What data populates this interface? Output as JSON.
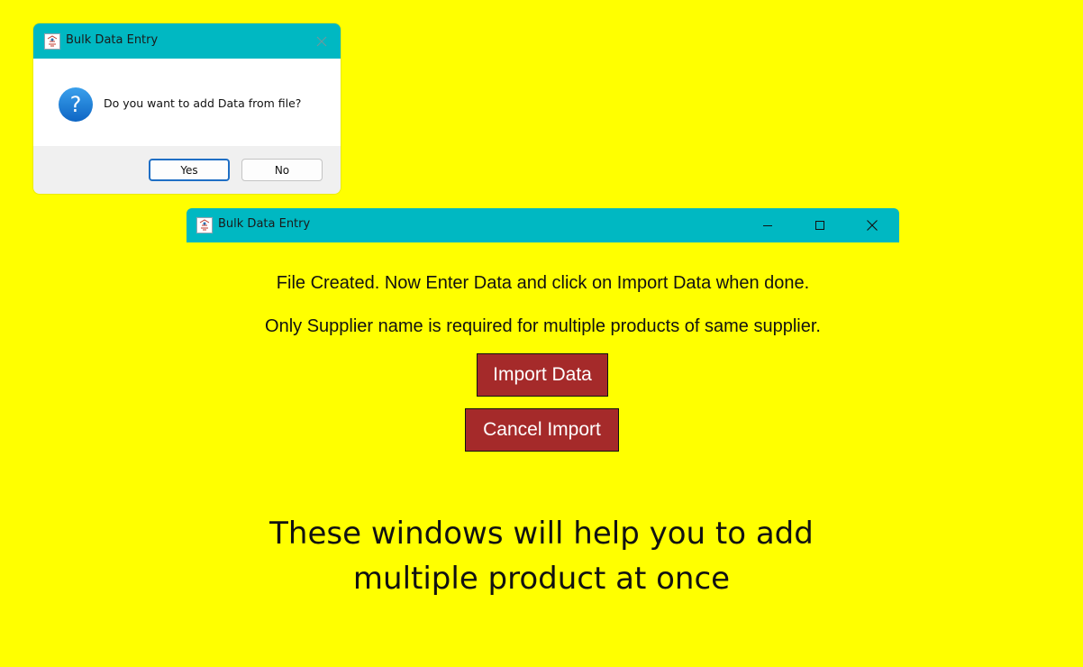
{
  "colors": {
    "background": "#ffff00",
    "titlebar": "#00b8c2",
    "action_button": "#a52a2a",
    "question_icon": "#1b7fd4"
  },
  "dialog": {
    "title": "Bulk Data Entry",
    "icon": "app-icon",
    "close_icon": "close-icon",
    "message": "Do you want to add Data from file?",
    "message_icon": "question-icon",
    "buttons": {
      "yes": "Yes",
      "no": "No"
    }
  },
  "window": {
    "title": "Bulk Data Entry",
    "icon": "app-icon",
    "controls": [
      "minimize-icon",
      "maximize-icon",
      "close-icon"
    ],
    "instruction_line1": "File Created. Now Enter Data and click on Import Data when done.",
    "instruction_line2": "Only Supplier name is required for multiple products of same supplier.",
    "import_button": "Import Data",
    "cancel_button": "Cancel Import"
  },
  "caption": {
    "line1": "These windows will help you to add",
    "line2": "multiple product at once"
  }
}
